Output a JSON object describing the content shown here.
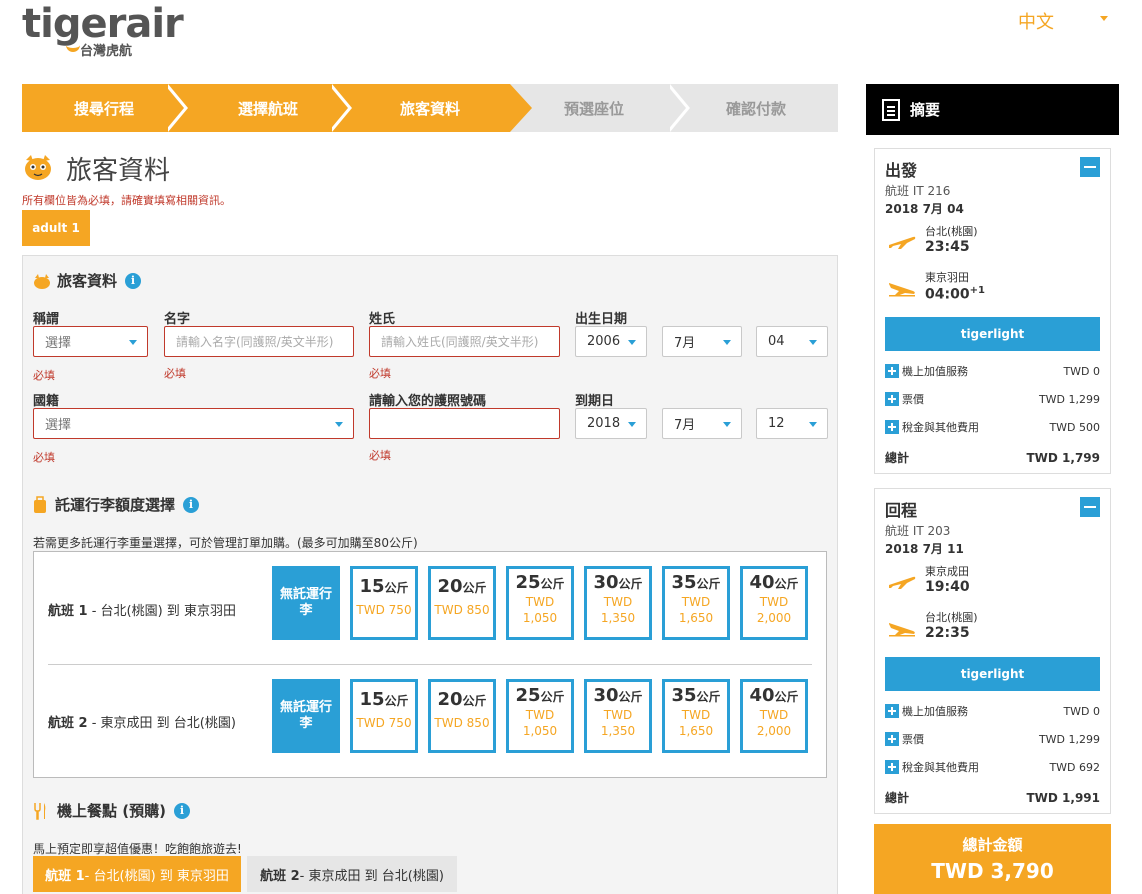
{
  "header": {
    "logo_word": "tigerair",
    "logo_sub": "台灣虎航",
    "language": "中文"
  },
  "steps": [
    "搜尋行程",
    "選擇航班",
    "旅客資料",
    "預選座位",
    "確認付款"
  ],
  "page": {
    "title": "旅客資料",
    "required_note": "所有欄位皆為必填，請確實填寫相關資訊。",
    "passenger_tab": "adult 1"
  },
  "passenger": {
    "section_title": "旅客資料",
    "title_label": "稱謂",
    "title_value": "選擇",
    "first_name_label": "名字",
    "first_name_placeholder": "請輸入名字(同護照/英文半形)",
    "last_name_label": "姓氏",
    "last_name_placeholder": "請輸入姓氏(同護照/英文半形)",
    "dob_label": "出生日期",
    "dob_year": "2006",
    "dob_month": "7月",
    "dob_day": "04",
    "nationality_label": "國籍",
    "nationality_value": "選擇",
    "passport_label": "請輸入您的護照號碼",
    "passport_value": "",
    "expiry_label": "到期日",
    "expiry_year": "2018",
    "expiry_month": "7月",
    "expiry_day": "12",
    "required_text": "必填"
  },
  "baggage": {
    "section_title": "託運行李額度選擇",
    "note": "若需更多託運行李重量選擇，可於管理訂單加購。(最多可加購至80公斤)",
    "none_label": "無託運行李",
    "unit": "公斤",
    "flights": [
      {
        "num": "航班 1",
        "route": " - 台北(桃園) 到 東京羽田"
      },
      {
        "num": "航班 2",
        "route": " - 東京成田 到 台北(桃園)"
      }
    ],
    "options": [
      {
        "kg": "15",
        "price1": "TWD 750",
        "price2": ""
      },
      {
        "kg": "20",
        "price1": "TWD 850",
        "price2": ""
      },
      {
        "kg": "25",
        "price1": "TWD",
        "price2": "1,050"
      },
      {
        "kg": "30",
        "price1": "TWD",
        "price2": "1,350"
      },
      {
        "kg": "35",
        "price1": "TWD",
        "price2": "1,650"
      },
      {
        "kg": "40",
        "price1": "TWD",
        "price2": "2,000"
      }
    ]
  },
  "meal": {
    "section_title": "機上餐點 (預購)",
    "note": "馬上預定即享超值優惠！吃飽飽旅遊去!",
    "tabs": [
      {
        "num": "航班 1",
        "route": " - 台北(桃園) 到 東京羽田"
      },
      {
        "num": "航班 2",
        "route": " - 東京成田 到 台北(桃園)"
      }
    ]
  },
  "summary": {
    "title": "摘要",
    "outbound": {
      "heading": "出發",
      "flight": "航班 IT 216",
      "date": "2018 7月 04",
      "dep_city": "台北(桃園)",
      "dep_time": "23:45",
      "arr_city": "東京羽田",
      "arr_time": "04:00",
      "arr_offset": "+1",
      "fare": "tigerlight",
      "addon_label": "機上加值服務",
      "addon_value": "TWD 0",
      "ticket_label": "票價",
      "ticket_value": "TWD 1,299",
      "tax_label": "稅金與其他費用",
      "tax_value": "TWD 500",
      "total_label": "總計",
      "total_value": "TWD 1,799"
    },
    "inbound": {
      "heading": "回程",
      "flight": "航班 IT 203",
      "date": "2018 7月 11",
      "dep_city": "東京成田",
      "dep_time": "19:40",
      "arr_city": "台北(桃園)",
      "arr_time": "22:35",
      "fare": "tigerlight",
      "addon_label": "機上加值服務",
      "addon_value": "TWD 0",
      "ticket_label": "票價",
      "ticket_value": "TWD 1,299",
      "tax_label": "稅金與其他費用",
      "tax_value": "TWD 692",
      "total_label": "總計",
      "total_value": "TWD 1,991"
    },
    "grand_label": "總計金額",
    "grand_value": "TWD 3,790"
  },
  "colors": {
    "accent": "#f5a623",
    "blue": "#2a9fd6",
    "error": "#c0392b"
  }
}
